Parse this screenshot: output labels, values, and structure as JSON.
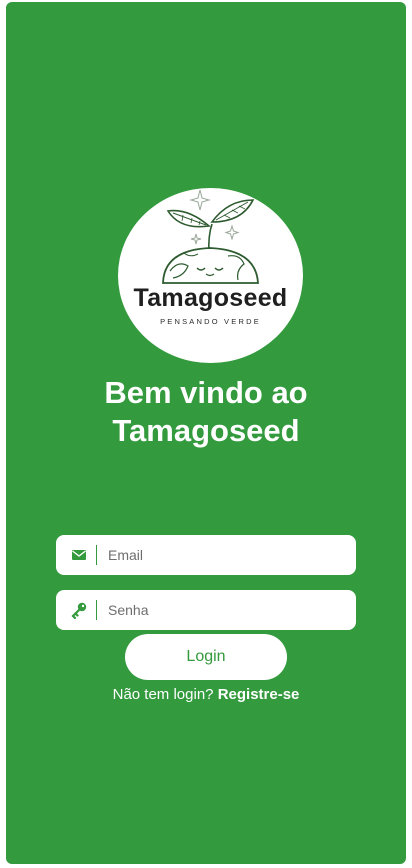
{
  "colors": {
    "background": "#339a3d",
    "accent": "#339a3d",
    "card": "#ffffff"
  },
  "logo": {
    "title": "Tamagoseed",
    "subtitle": "PENSANDO VERDE",
    "icon": "sprouting-globe-logo"
  },
  "welcome": {
    "line1": "Bem vindo ao",
    "line2": "Tamagoseed"
  },
  "form": {
    "email": {
      "icon": "mail-icon",
      "placeholder": "Email",
      "value": ""
    },
    "password": {
      "icon": "key-icon",
      "placeholder": "Senha",
      "value": ""
    },
    "login_label": "Login"
  },
  "register": {
    "prompt": "Não tem login?",
    "link": "Registre-se"
  }
}
